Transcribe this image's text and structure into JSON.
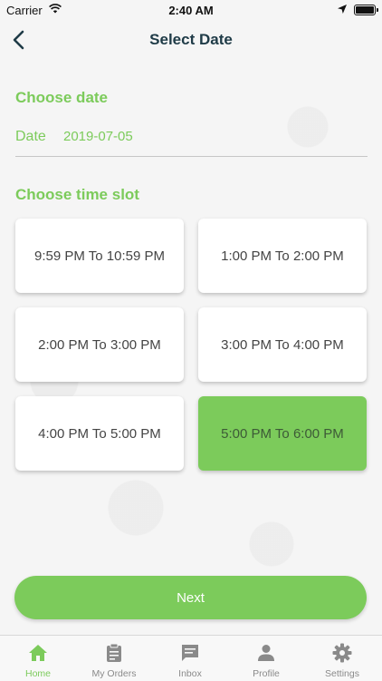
{
  "status_bar": {
    "carrier": "Carrier",
    "time": "2:40 AM"
  },
  "header": {
    "title": "Select Date"
  },
  "choose_date": {
    "title": "Choose date",
    "field_label": "Date",
    "field_value": "2019-07-05"
  },
  "choose_slot": {
    "title": "Choose time slot",
    "slots": [
      {
        "label": "9:59 PM To 10:59 PM",
        "selected": false
      },
      {
        "label": "1:00 PM To 2:00 PM",
        "selected": false
      },
      {
        "label": "2:00 PM To 3:00 PM",
        "selected": false
      },
      {
        "label": "3:00 PM To 4:00 PM",
        "selected": false
      },
      {
        "label": "4:00 PM To 5:00 PM",
        "selected": false
      },
      {
        "label": "5:00 PM To 6:00 PM",
        "selected": true
      }
    ]
  },
  "next_button": {
    "label": "Next"
  },
  "tab_bar": {
    "tabs": [
      {
        "label": "Home",
        "icon": "home-icon",
        "active": true
      },
      {
        "label": "My Orders",
        "icon": "clipboard-icon",
        "active": false
      },
      {
        "label": "Inbox",
        "icon": "message-icon",
        "active": false
      },
      {
        "label": "Profile",
        "icon": "person-icon",
        "active": false
      },
      {
        "label": "Settings",
        "icon": "gear-icon",
        "active": false
      }
    ]
  },
  "colors": {
    "accent": "#7ccb5b",
    "title": "#1f3b47",
    "tab_inactive": "#8a8a8a"
  }
}
